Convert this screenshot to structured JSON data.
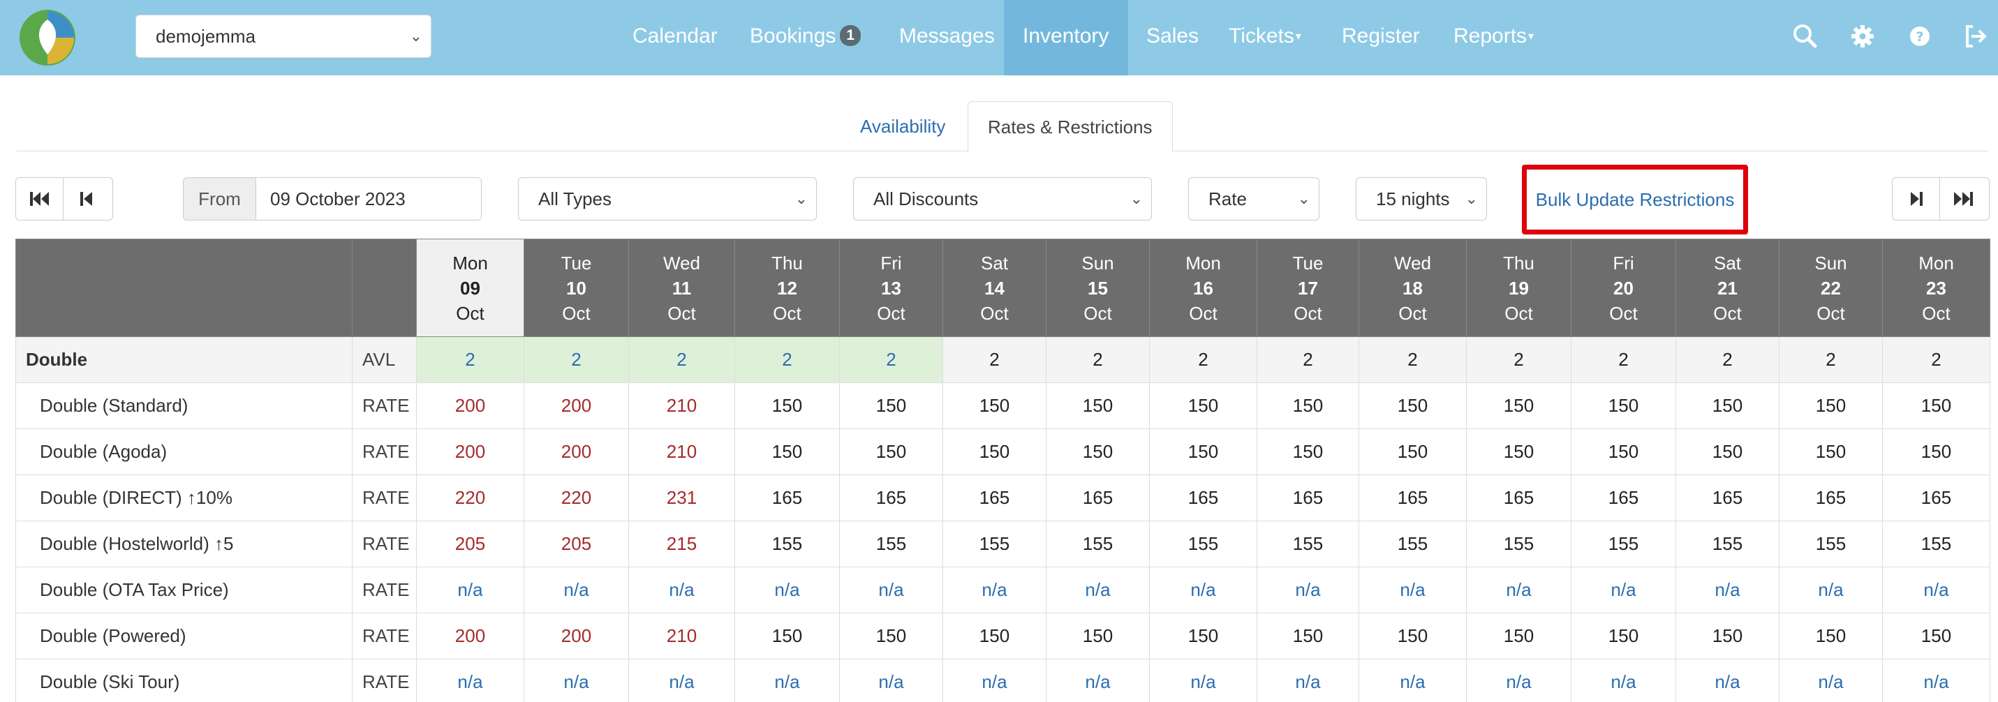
{
  "nav": {
    "property_selected": "demojemma",
    "items": [
      {
        "label": "Calendar"
      },
      {
        "label": "Bookings",
        "badge": "1"
      },
      {
        "label": "Messages"
      },
      {
        "label": "Inventory",
        "active": true
      },
      {
        "label": "Sales"
      },
      {
        "label": "Tickets"
      },
      {
        "label": "Register"
      },
      {
        "label": "Reports"
      }
    ],
    "icons": [
      "search-icon",
      "gear-icon",
      "help-icon",
      "logout-icon"
    ],
    "colors": {
      "bar": "#8ecae6",
      "active": "#73b8dc"
    }
  },
  "tabs": [
    {
      "label": "Availability",
      "active": false
    },
    {
      "label": "Rates & Restrictions",
      "active": true
    }
  ],
  "toolbar": {
    "from_label": "From",
    "from_value": "09 October 2023",
    "types_selected": "All Types",
    "discounts_selected": "All Discounts",
    "view_selected": "Rate",
    "nights_selected": "15 nights",
    "bulk_label": "Bulk Update Restrictions",
    "highlight_color": "#e0000b"
  },
  "grid": {
    "days": [
      {
        "dow": "Mon",
        "day": "09",
        "mon": "Oct"
      },
      {
        "dow": "Tue",
        "day": "10",
        "mon": "Oct"
      },
      {
        "dow": "Wed",
        "day": "11",
        "mon": "Oct"
      },
      {
        "dow": "Thu",
        "day": "12",
        "mon": "Oct"
      },
      {
        "dow": "Fri",
        "day": "13",
        "mon": "Oct"
      },
      {
        "dow": "Sat",
        "day": "14",
        "mon": "Oct"
      },
      {
        "dow": "Sun",
        "day": "15",
        "mon": "Oct"
      },
      {
        "dow": "Mon",
        "day": "16",
        "mon": "Oct"
      },
      {
        "dow": "Tue",
        "day": "17",
        "mon": "Oct"
      },
      {
        "dow": "Wed",
        "day": "18",
        "mon": "Oct"
      },
      {
        "dow": "Thu",
        "day": "19",
        "mon": "Oct"
      },
      {
        "dow": "Fri",
        "day": "20",
        "mon": "Oct"
      },
      {
        "dow": "Sat",
        "day": "21",
        "mon": "Oct"
      },
      {
        "dow": "Sun",
        "day": "22",
        "mon": "Oct"
      },
      {
        "dow": "Mon",
        "day": "23",
        "mon": "Oct"
      }
    ],
    "today_index": 0,
    "group": {
      "label": "Double",
      "type": "AVL",
      "values": [
        "2",
        "2",
        "2",
        "2",
        "2",
        "2",
        "2",
        "2",
        "2",
        "2",
        "2",
        "2",
        "2",
        "2",
        "2"
      ],
      "blue_count": 5
    },
    "rows": [
      {
        "label": "Double (Standard)",
        "type": "RATE",
        "values": [
          "200",
          "200",
          "210",
          "150",
          "150",
          "150",
          "150",
          "150",
          "150",
          "150",
          "150",
          "150",
          "150",
          "150",
          "150"
        ]
      },
      {
        "label": "Double (Agoda)",
        "type": "RATE",
        "values": [
          "200",
          "200",
          "210",
          "150",
          "150",
          "150",
          "150",
          "150",
          "150",
          "150",
          "150",
          "150",
          "150",
          "150",
          "150"
        ]
      },
      {
        "label": "Double (DIRECT) ↑10%",
        "type": "RATE",
        "values": [
          "220",
          "220",
          "231",
          "165",
          "165",
          "165",
          "165",
          "165",
          "165",
          "165",
          "165",
          "165",
          "165",
          "165",
          "165"
        ]
      },
      {
        "label": "Double (Hostelworld) ↑5",
        "type": "RATE",
        "values": [
          "205",
          "205",
          "215",
          "155",
          "155",
          "155",
          "155",
          "155",
          "155",
          "155",
          "155",
          "155",
          "155",
          "155",
          "155"
        ]
      },
      {
        "label": "Double (OTA Tax Price)",
        "type": "RATE",
        "values": [
          "n/a",
          "n/a",
          "n/a",
          "n/a",
          "n/a",
          "n/a",
          "n/a",
          "n/a",
          "n/a",
          "n/a",
          "n/a",
          "n/a",
          "n/a",
          "n/a",
          "n/a"
        ]
      },
      {
        "label": "Double (Powered)",
        "type": "RATE",
        "values": [
          "200",
          "200",
          "210",
          "150",
          "150",
          "150",
          "150",
          "150",
          "150",
          "150",
          "150",
          "150",
          "150",
          "150",
          "150"
        ]
      },
      {
        "label": "Double (Ski Tour)",
        "type": "RATE",
        "values": [
          "n/a",
          "n/a",
          "n/a",
          "n/a",
          "n/a",
          "n/a",
          "n/a",
          "n/a",
          "n/a",
          "n/a",
          "n/a",
          "n/a",
          "n/a",
          "n/a",
          "n/a"
        ]
      }
    ],
    "red_first_n": 3
  }
}
